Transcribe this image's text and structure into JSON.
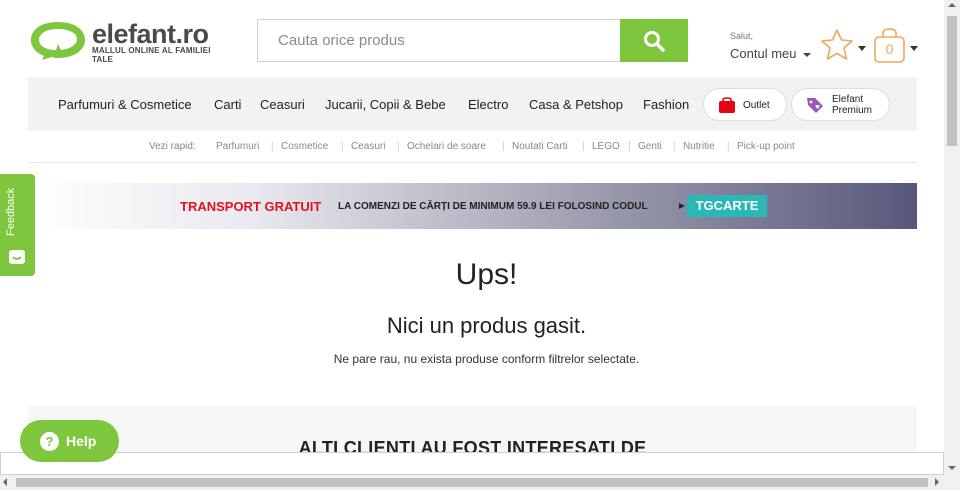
{
  "header": {
    "logo_text": "elefant.ro",
    "logo_tagline": "MALLUL ONLINE AL FAMILIEI TALE",
    "search_placeholder": "Cauta orice produs",
    "salut": "Salut,",
    "account": "Contul meu",
    "cart_count": "0"
  },
  "nav": {
    "items": [
      "Parfumuri & Cosmetice",
      "Carti",
      "Ceasuri",
      "Jucarii, Copii & Bebe",
      "Electro",
      "Casa & Petshop",
      "Fashion"
    ],
    "outlet": "Outlet",
    "premium_line1": "Elefant",
    "premium_line2": "Premium"
  },
  "quick_links": {
    "label": "Vezi rapid:",
    "items": [
      "Parfumuri",
      "Cosmetice",
      "Ceasuri",
      "Ochelari de soare",
      "Noutati Carti",
      "LEGO",
      "Genti",
      "Nutritie",
      "Pick-up point"
    ]
  },
  "banner": {
    "highlight": "TRANSPORT GRATUIT",
    "text": "LA COMENZI DE CĂRȚI DE MINIMUM 59.9 LEI FOLOSIND CODUL",
    "code": "TGCARTE"
  },
  "message": {
    "title": "Ups!",
    "subtitle": "Nici un produs gasit.",
    "detail": "Ne pare rau, nu exista produse conform filtrelor selectate."
  },
  "also_title": "ALTI CLIENTI AU FOST INTERESATI DE",
  "feedback_label": "Feedback",
  "help_label": "Help",
  "colors": {
    "brand_green": "#7dc63d",
    "banner_red": "#e1131f",
    "code_teal": "#2ab7b7"
  }
}
